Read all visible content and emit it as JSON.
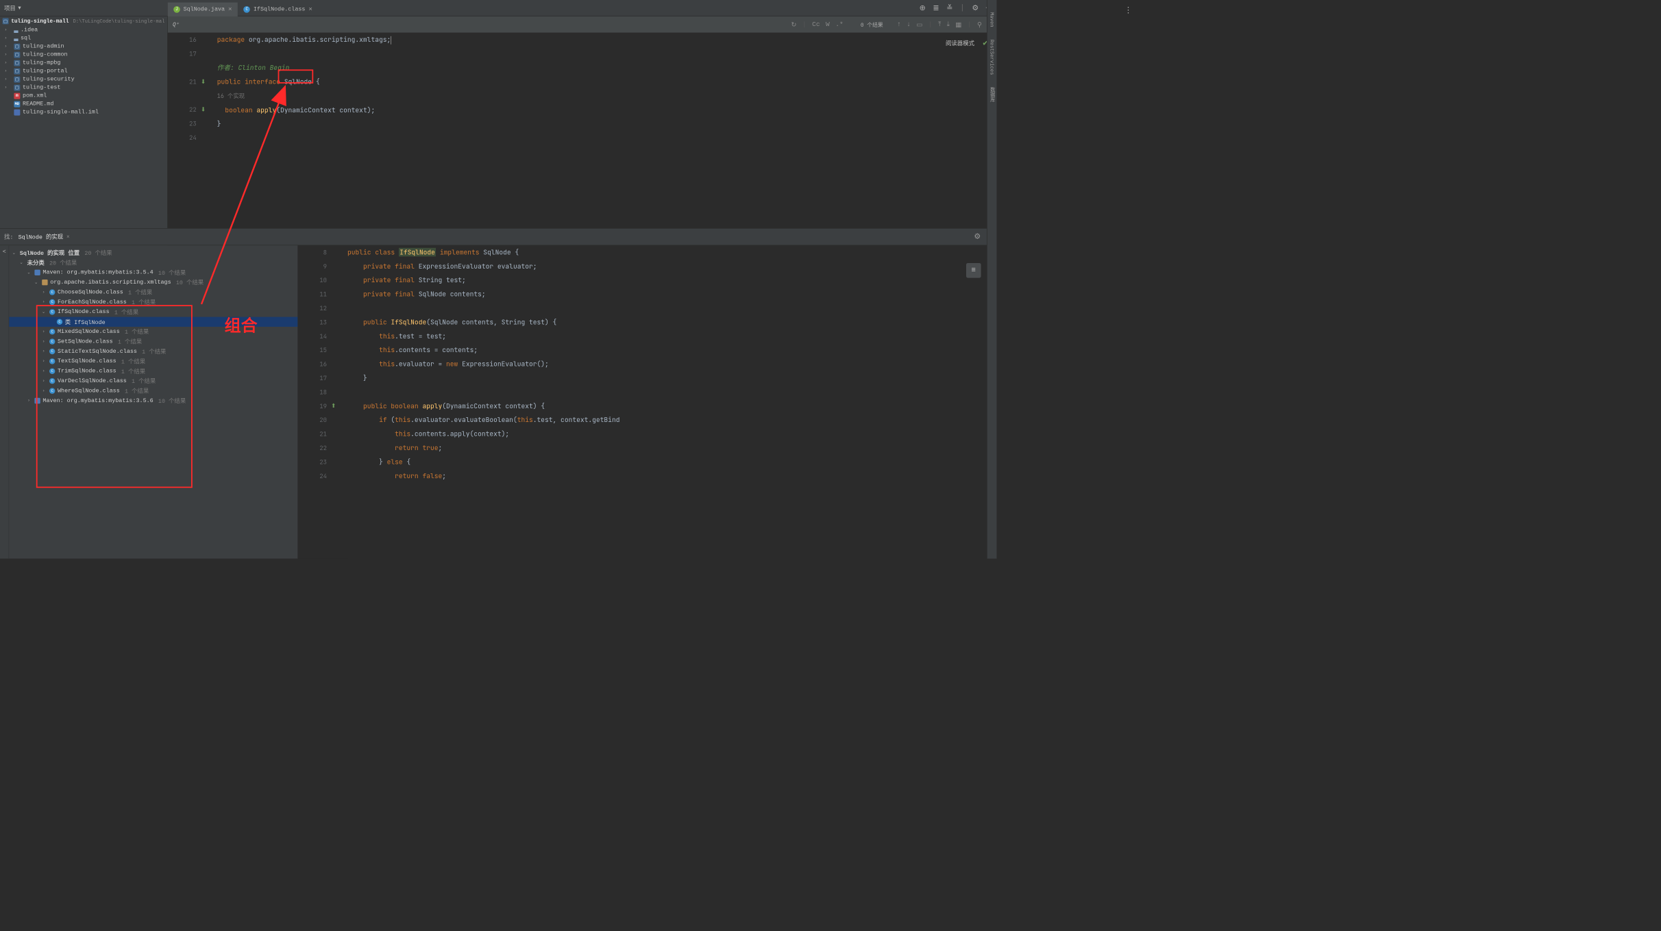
{
  "topbar": {
    "project_label": "项目"
  },
  "project_tree": {
    "root_name": "tuling-single-mall",
    "root_path": "D:\\TuLingCode\\tuling-single-mal",
    "items": [
      {
        "icon": "folder",
        "label": ".idea"
      },
      {
        "icon": "folder",
        "label": "sql"
      },
      {
        "icon": "module",
        "label": "tuling-admin"
      },
      {
        "icon": "module",
        "label": "tuling-common"
      },
      {
        "icon": "module",
        "label": "tuling-mpbg"
      },
      {
        "icon": "module",
        "label": "tuling-portal"
      },
      {
        "icon": "module",
        "label": "tuling-security"
      },
      {
        "icon": "module",
        "label": "tuling-test"
      },
      {
        "icon": "maven",
        "label": "pom.xml",
        "noarrow": true
      },
      {
        "icon": "md",
        "label": "README.md",
        "noarrow": true
      },
      {
        "icon": "file",
        "label": "tuling-single-mall.iml",
        "noarrow": true
      }
    ]
  },
  "tabs": [
    {
      "icon": "java",
      "label": "SqlNode.java",
      "active": true
    },
    {
      "icon": "class",
      "label": "IfSqlNode.class",
      "active": false
    }
  ],
  "searchbar": {
    "prompt": "Q⁺",
    "cc": "Cc",
    "w": "W",
    "star": ".*",
    "result_count": "0 个结果"
  },
  "editor_top": {
    "lines": [
      {
        "n": 16,
        "html": "<span class='kw'>package</span> org.apache.ibatis.scripting.xmltags;<span class='cursor'></span>"
      },
      {
        "n": 17,
        "html": ""
      },
      {
        "n": "",
        "html": "<span class='doc'>作者: Clinton Begin</span>"
      },
      {
        "n": 21,
        "impl": true,
        "html": "<span class='kw'>public</span> <span class='kw'>interface</span> <span id='sqlnode-word'>SqlNode</span> {"
      },
      {
        "n": "",
        "html": "<span class='inlay'>16 个实现</span>"
      },
      {
        "n": 22,
        "impl": true,
        "html": "&nbsp;&nbsp;<span class='kw'>boolean</span> <span class='def'>apply</span>(D<span class='cursor-overlay'>y</span>namicContext context);"
      },
      {
        "n": 23,
        "html": "}"
      },
      {
        "n": 24,
        "html": ""
      }
    ],
    "reader_mode": "阅读器模式"
  },
  "bottom_header": {
    "prefix": "找:",
    "title": "SqlNode 的实现"
  },
  "results": {
    "root_title": "SqlNode 的实现 位置",
    "root_count": "20 个结果",
    "uncat": "未分类",
    "uncat_count": "20 个结果",
    "maven1": "Maven: org.mybatis:mybatis:3.5.4",
    "maven1_count": "10 个结果",
    "pkg": "org.apache.ibatis.scripting.xmltags",
    "pkg_count": "10 个结果",
    "classes": [
      {
        "name": "ChooseSqlNode.class",
        "count": "1 个结果"
      },
      {
        "name": "ForEachSqlNode.class",
        "count": "1 个结果"
      },
      {
        "name": "IfSqlNode.class",
        "count": "1 个结果",
        "expanded": true,
        "child": "类  IfSqlNode"
      },
      {
        "name": "MixedSqlNode.class",
        "count": "1 个结果"
      },
      {
        "name": "SetSqlNode.class",
        "count": "1 个结果"
      },
      {
        "name": "StaticTextSqlNode.class",
        "count": "1 个结果"
      },
      {
        "name": "TextSqlNode.class",
        "count": "1 个结果"
      },
      {
        "name": "TrimSqlNode.class",
        "count": "1 个结果"
      },
      {
        "name": "VarDeclSqlNode.class",
        "count": "1 个结果"
      },
      {
        "name": "WhereSqlNode.class",
        "count": "1 个结果"
      }
    ],
    "maven2": "Maven: org.mybatis:mybatis:3.5.6",
    "maven2_count": "10 个结果"
  },
  "editor_bot": {
    "lines": [
      {
        "n": 8,
        "html": "<span class='kw'>public</span> <span class='kw'>class</span> <span class='cls-name-hl'>IfSqlNode</span> <span class='kw'>implements</span> SqlNode {"
      },
      {
        "n": 9,
        "html": "&nbsp;&nbsp;&nbsp;&nbsp;<span class='kw'>private</span> <span class='kw'>final</span> ExpressionEvaluator evaluator;"
      },
      {
        "n": 10,
        "html": "&nbsp;&nbsp;&nbsp;&nbsp;<span class='kw'>private</span> <span class='kw'>final</span> String test;"
      },
      {
        "n": 11,
        "html": "&nbsp;&nbsp;&nbsp;&nbsp;<span class='kw'>private</span> <span class='kw'>final</span> SqlNode contents;"
      },
      {
        "n": 12,
        "html": ""
      },
      {
        "n": 13,
        "html": "&nbsp;&nbsp;&nbsp;&nbsp;<span class='kw'>public</span> <span class='def'>IfSqlNode</span>(SqlNode contents, String test) {"
      },
      {
        "n": 14,
        "html": "&nbsp;&nbsp;&nbsp;&nbsp;&nbsp;&nbsp;&nbsp;&nbsp;<span class='kw'>this</span>.test = test;"
      },
      {
        "n": 15,
        "html": "&nbsp;&nbsp;&nbsp;&nbsp;&nbsp;&nbsp;&nbsp;&nbsp;<span class='kw'>this</span>.contents = contents;"
      },
      {
        "n": 16,
        "html": "&nbsp;&nbsp;&nbsp;&nbsp;&nbsp;&nbsp;&nbsp;&nbsp;<span class='kw'>this</span>.evaluator = <span class='kw'>new</span> ExpressionEvaluator();"
      },
      {
        "n": 17,
        "html": "&nbsp;&nbsp;&nbsp;&nbsp;}"
      },
      {
        "n": 18,
        "html": ""
      },
      {
        "n": 19,
        "impl": true,
        "html": "&nbsp;&nbsp;&nbsp;&nbsp;<span class='kw'>public</span> <span class='kw'>boolean</span> <span class='def'>apply</span>(DynamicContext context) {"
      },
      {
        "n": 20,
        "html": "&nbsp;&nbsp;&nbsp;&nbsp;&nbsp;&nbsp;&nbsp;&nbsp;<span class='kw'>if</span> (<span class='kw'>this</span>.evaluator.evaluateBoolean(<span class='kw'>this</span>.test, context.getBind"
      },
      {
        "n": 21,
        "html": "&nbsp;&nbsp;&nbsp;&nbsp;&nbsp;&nbsp;&nbsp;&nbsp;&nbsp;&nbsp;&nbsp;&nbsp;<span class='kw'>this</span>.contents.apply(context);"
      },
      {
        "n": 22,
        "html": "&nbsp;&nbsp;&nbsp;&nbsp;&nbsp;&nbsp;&nbsp;&nbsp;&nbsp;&nbsp;&nbsp;&nbsp;<span class='kw'>return</span> <span class='kw'>true</span>;"
      },
      {
        "n": 23,
        "html": "&nbsp;&nbsp;&nbsp;&nbsp;&nbsp;&nbsp;&nbsp;&nbsp;} <span class='kw'>else</span> {"
      },
      {
        "n": 24,
        "html": "&nbsp;&nbsp;&nbsp;&nbsp;&nbsp;&nbsp;&nbsp;&nbsp;&nbsp;&nbsp;&nbsp;&nbsp;<span class='kw'>return</span> <span class='kw'>false</span>;"
      }
    ]
  },
  "annotation": {
    "label": "组合"
  },
  "rightstrip": {
    "t1": "Maven",
    "t2": "RestServices",
    "t3": "数据库"
  }
}
